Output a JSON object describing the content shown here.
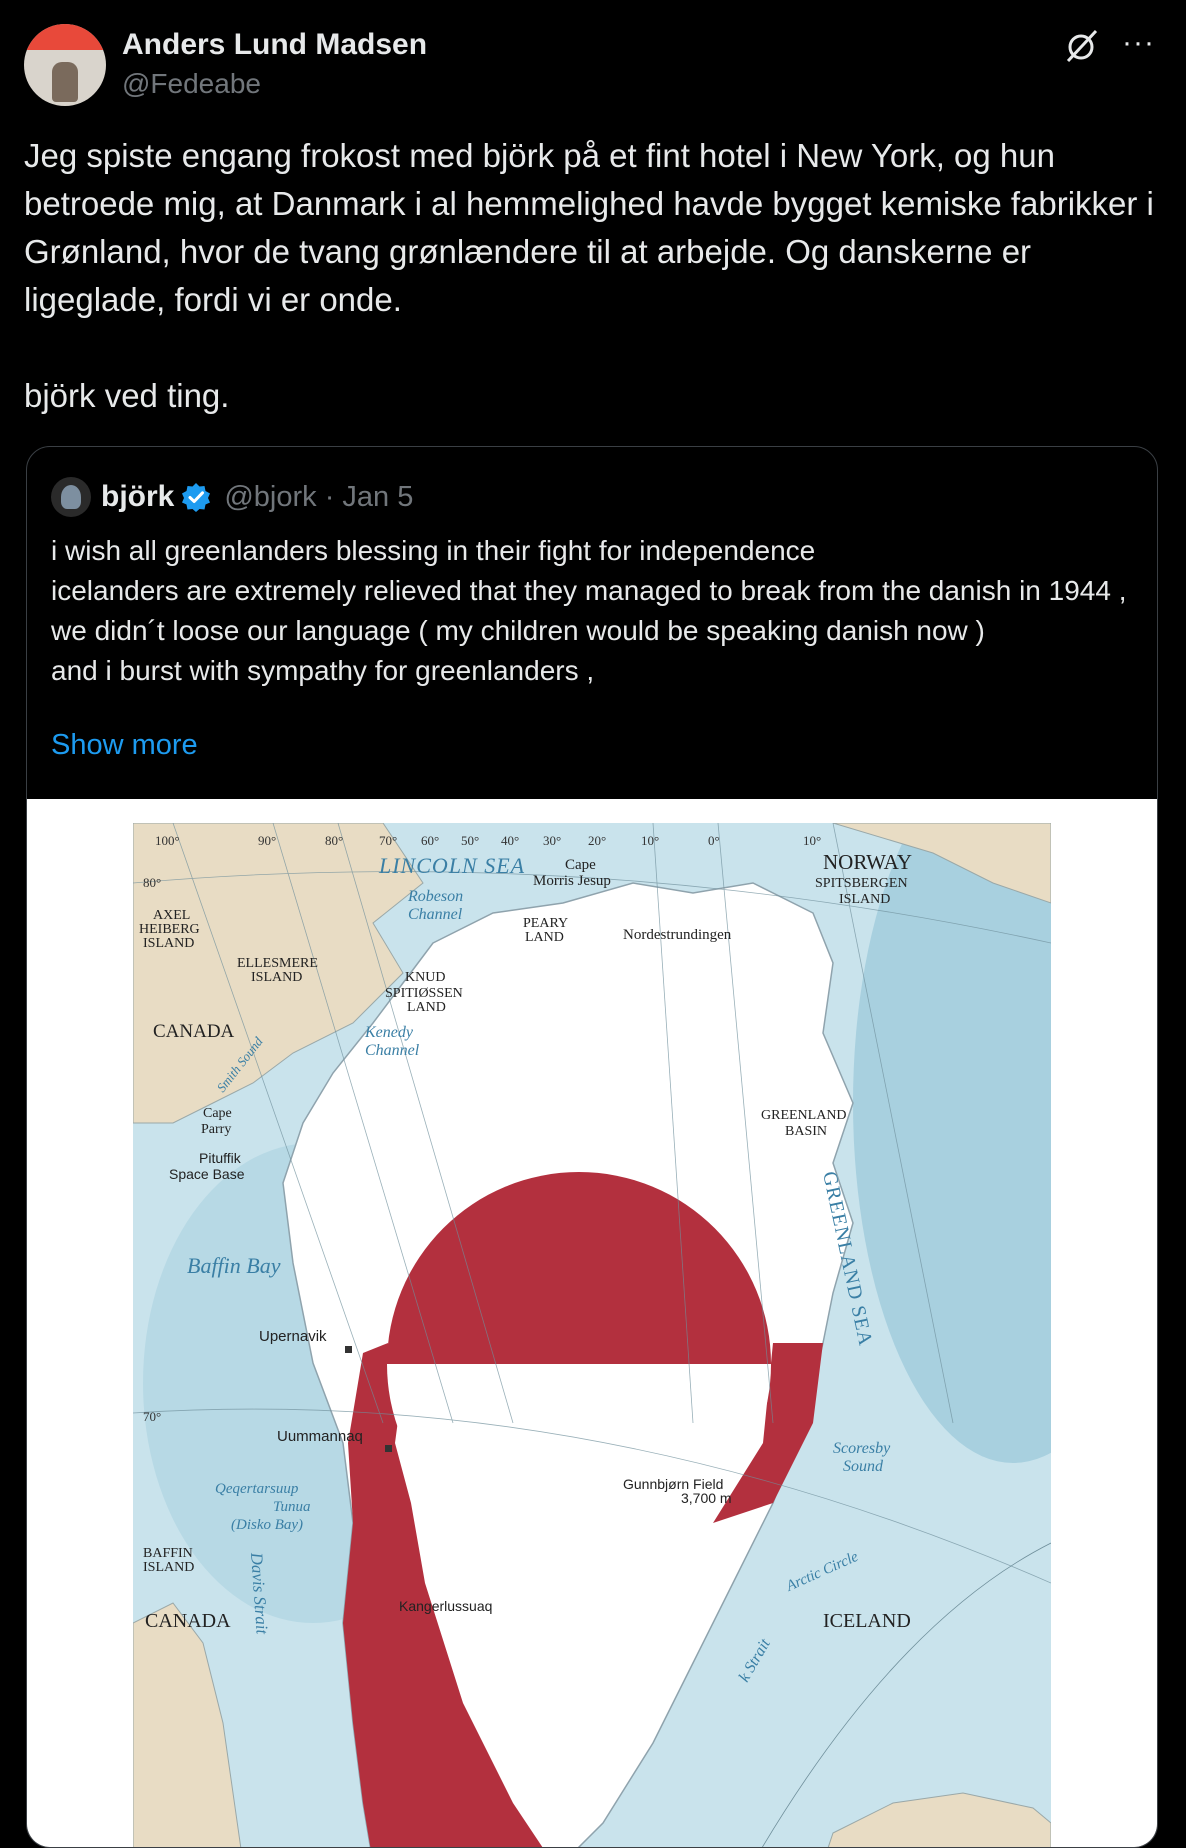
{
  "author": {
    "display_name": "Anders Lund Madsen",
    "handle": "@Fedeabe"
  },
  "tweet": {
    "paragraph_1": "Jeg spiste engang frokost med björk på et fint hotel i New York, og hun betroede mig, at Danmark i al hemmelighed havde bygget kemiske fabrikker i Grønland, hvor de tvang grønlændere til at arbejde. Og danskerne er ligeglade, fordi vi er onde.",
    "paragraph_2": "björk ved ting."
  },
  "icons": {
    "grok": "grok-icon",
    "more": "more-icon",
    "verified": "verified-badge-icon",
    "more_glyph": "···"
  },
  "quoted_tweet": {
    "display_name": "björk",
    "handle_date": "@bjork · Jan 5",
    "lines": [
      "i wish all greenlanders blessing in their fight for independence",
      "icelanders are extremely relieved that they managed to break from the danish in 1944 ,",
      "we didn´t loose our language ( my children would be speaking danish now )",
      "and i burst with sympathy for greenlanders ,"
    ],
    "show_more": "Show more"
  },
  "map": {
    "longitudes": [
      "100°",
      "90°",
      "80°",
      "70°",
      "60°",
      "50°",
      "40°",
      "30°",
      "20°",
      "10°",
      "0°",
      "10°"
    ],
    "latitudes": [
      "80°",
      "70°"
    ],
    "labels": {
      "lincoln_sea": "LINCOLN SEA",
      "cape_morris_jesup_1": "Cape",
      "cape_morris_jesup_2": "Morris Jesup",
      "robeson_1": "Robeson",
      "robeson_2": "Channel",
      "peary_1": "PEARY",
      "peary_2": "LAND",
      "nordestrundingen": "Nordestrundingen",
      "norway": "NORWAY",
      "spitsbergen_1": "SPITSBERGEN",
      "spitsbergen_2": "ISLAND",
      "axel_1": "AXEL",
      "axel_2": "HEIBERG",
      "axel_3": "ISLAND",
      "ellesmere_1": "ELLESMERE",
      "ellesmere_2": "ISLAND",
      "knud_1": "KNUD",
      "knud_2": "SPITIØSSEN",
      "knud_3": "LAND",
      "kennedy_1": "Kenedy",
      "kennedy_2": "Channel",
      "canada_top": "CANADA",
      "smith_sound": "Smith Sound",
      "cape_parry_1": "Cape",
      "cape_parry_2": "Parry",
      "pituffik_1": "Pituffik",
      "pituffik_2": "Space Base",
      "greenland_basin_1": "GREENLAND",
      "greenland_basin_2": "BASIN",
      "greenland_sea": "GREENLAND SEA",
      "baffin_bay": "Baffin Bay",
      "upernavik": "Upernavik",
      "uummannaq": "Uummannaq",
      "qeqertarsuup_1": "Qeqertarsuup",
      "qeqertarsuup_2": "Tunua",
      "qeqertarsuup_3": "(Disko Bay)",
      "gunnbjorn_1": "Gunnbjørn Field",
      "gunnbjorn_2": "3,700 m",
      "scoresby_1": "Scoresby",
      "scoresby_2": "Sound",
      "baffin_island_1": "BAFFIN",
      "baffin_island_2": "ISLAND",
      "canada_bottom": "CANADA",
      "davis_strait": "Davis Strait",
      "kangerlussuaq": "Kangerlussuaq",
      "arctic_circle": "Arctic Circle",
      "denmark_strait": "k Strait",
      "iceland": "ICELAND"
    },
    "colors": {
      "ocean": "#c9e3ec",
      "deep_ocean": "#a8d0df",
      "land_other": "#e8dcc4",
      "greenland": "#ffffff",
      "flag_red": "#b3303e"
    }
  }
}
